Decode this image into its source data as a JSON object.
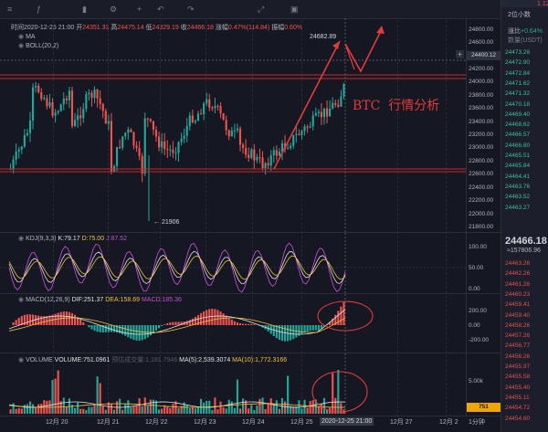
{
  "toolbar": {
    "items": [
      "",
      "",
      "",
      "",
      "",
      "",
      "",
      "",
      "",
      "",
      ""
    ]
  },
  "info_bar": {
    "time_label": "时间2020-12-25 21:00",
    "open_label": "开",
    "open_value": "24351.33",
    "high_label": "高",
    "high_value": "24475.14",
    "low_label": "低",
    "low_value": "24329.19",
    "close_label": "收",
    "close_value": "24466.18",
    "change_label": "涨幅",
    "change_value": "0.47%(114.84)",
    "amplitude_label": "振幅",
    "amplitude_value": "0.60%"
  },
  "indicators": {
    "ma": "MA",
    "boll": "BOLL(20,2)"
  },
  "price_axis": [
    "24800.00",
    "24600.00",
    "24400.00",
    "24200.00",
    "24000.00",
    "23800.00",
    "23600.00",
    "23400.00",
    "23200.00",
    "23000.00",
    "22800.00",
    "22600.00",
    "22400.00",
    "22200.00",
    "22000.00",
    "21800.00"
  ],
  "price_markers": {
    "high_marker": "24682.89",
    "low_marker": "21906",
    "current_price_box": "24400.12"
  },
  "annotation": {
    "title": "BTC  行情分析"
  },
  "kdj": {
    "label": "KDJ(9,3,3)",
    "k": "K:79.17",
    "d": "D:75.00",
    "j": "J:87.52",
    "axis": [
      "100.00",
      "50.00",
      "0.00"
    ]
  },
  "macd": {
    "label": "MACD(12,26,9)",
    "dif": "DIF:251.37",
    "dea": "DEA:158.69",
    "macd": "MACD:185.36",
    "axis": [
      "200.00",
      "0.00",
      "-200.00"
    ]
  },
  "volume": {
    "label": "VOLUME",
    "value": "VOLUME:751.0961",
    "faded": "预估成交量:1,181.7946",
    "ma5": "MA(5):2,539.3074",
    "ma10": "MA(10):1,772.3166",
    "axis": [
      "5.00k"
    ],
    "current_box": "751"
  },
  "time_axis": [
    "12月 20",
    "12月 21",
    "12月 22",
    "12月 23",
    "12月 24",
    "12月 25",
    "2020-12-25 21:00",
    "12月 27",
    "12月 2"
  ],
  "corner_label": "1分钟",
  "side_panel": {
    "title": "2位小数",
    "pct_label": "涨比",
    "pct_value": "+0.64%",
    "pct_right": "1.12",
    "unit": "数量(USDT)",
    "asks": [
      "24473.26",
      "24472.90",
      "24472.84",
      "24471.62",
      "24471.32",
      "24470.18",
      "24469.40",
      "24468.62",
      "24466.57",
      "24466.80",
      "24465.51",
      "24465.84",
      "24464.41",
      "24463.76",
      "24463.52",
      "24463.27"
    ],
    "last_price": "24466.18",
    "last_cny": "≈157806.96",
    "bids": [
      "24463.26",
      "24462.26",
      "24461.26",
      "24460.23",
      "24459.41",
      "24459.40",
      "24458.26",
      "24457.26",
      "24456.77",
      "24456.26",
      "24455.97",
      "24455.58",
      "24455.40",
      "24455.11",
      "24454.72",
      "24454.60"
    ]
  },
  "colors": {
    "up": "#26a69a",
    "down": "#ef5350",
    "background": "#131722",
    "annotation": "#e23b3b"
  }
}
